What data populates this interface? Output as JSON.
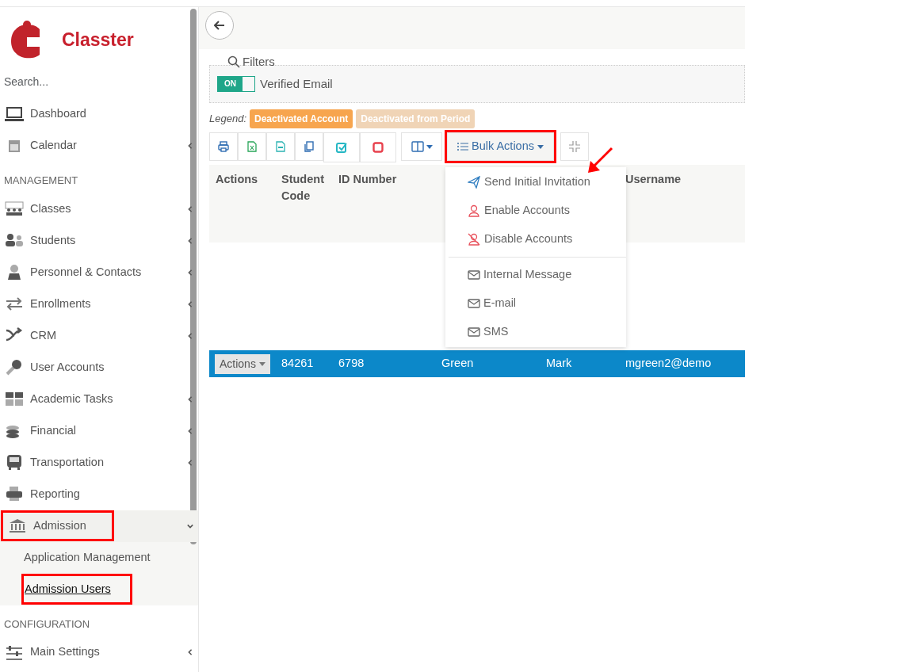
{
  "sidebar": {
    "logo": "Classter",
    "search": {
      "placeholder": "Search..."
    },
    "sections": [
      {
        "items": [
          {
            "label": "Dashboard",
            "has_submenu": false,
            "expanded": false,
            "highlighted": false
          },
          {
            "label": "Calendar",
            "has_submenu": true,
            "expanded": false,
            "highlighted": false
          }
        ]
      },
      {
        "heading": "MANAGEMENT",
        "items": [
          {
            "label": "Classes",
            "has_submenu": true,
            "expanded": false,
            "highlighted": false
          },
          {
            "label": "Students",
            "has_submenu": true,
            "expanded": false,
            "highlighted": false
          },
          {
            "label": "Personnel & Contacts",
            "has_submenu": true,
            "expanded": false,
            "highlighted": false
          },
          {
            "label": "Enrollments",
            "has_submenu": true,
            "expanded": false,
            "highlighted": false
          },
          {
            "label": "CRM",
            "has_submenu": true,
            "expanded": false,
            "highlighted": false
          },
          {
            "label": "User Accounts",
            "has_submenu": false,
            "expanded": false,
            "highlighted": false
          },
          {
            "label": "Academic Tasks",
            "has_submenu": true,
            "expanded": false,
            "highlighted": false
          },
          {
            "label": "Financial",
            "has_submenu": true,
            "expanded": false,
            "highlighted": false
          },
          {
            "label": "Transportation",
            "has_submenu": true,
            "expanded": false,
            "highlighted": false
          },
          {
            "label": "Reporting",
            "has_submenu": false,
            "expanded": false,
            "highlighted": false
          },
          {
            "label": "Admission",
            "has_submenu": true,
            "expanded": true,
            "highlighted": true,
            "children": [
              {
                "label": "Application Management",
                "selected": false,
                "highlighted": false
              },
              {
                "label": "Admission Users",
                "selected": true,
                "highlighted": true
              }
            ]
          }
        ]
      },
      {
        "heading": "CONFIGURATION",
        "items": [
          {
            "label": "Main Settings",
            "has_submenu": true,
            "expanded": false,
            "highlighted": false
          }
        ]
      }
    ]
  },
  "filters": {
    "title": "Filters",
    "toggle": {
      "label": "ON",
      "on": true
    },
    "toggle_label": "Verified Email"
  },
  "legend": {
    "label": "Legend:",
    "items": [
      {
        "label": "Deactivated Account",
        "color": "#f7a54e"
      },
      {
        "label": "Deactivated from Period",
        "color": "#f0d4b6"
      }
    ]
  },
  "toolbar": {
    "bulk_actions": {
      "label": "Bulk Actions",
      "highlighted": true,
      "expanded": true
    }
  },
  "bulk_menu": [
    {
      "label": "Send Initial Invitation",
      "kind": "send",
      "annotated": true
    },
    {
      "label": "Enable Accounts",
      "kind": "enable",
      "annotated": false
    },
    {
      "label": "Disable Accounts",
      "kind": "disable",
      "annotated": false
    },
    {
      "label": "Internal Message",
      "kind": "mail",
      "annotated": false
    },
    {
      "label": "E-mail",
      "kind": "mail",
      "annotated": false
    },
    {
      "label": "SMS",
      "kind": "mail",
      "annotated": false
    }
  ],
  "table": {
    "columns": [
      "Actions",
      "Student Code",
      "ID Number",
      "",
      "",
      "Username"
    ],
    "rows": [
      {
        "selected": true,
        "cells": [
          "Actions",
          "84261",
          "6798",
          "Green",
          "Mark",
          "mgreen2@demo"
        ]
      }
    ]
  }
}
